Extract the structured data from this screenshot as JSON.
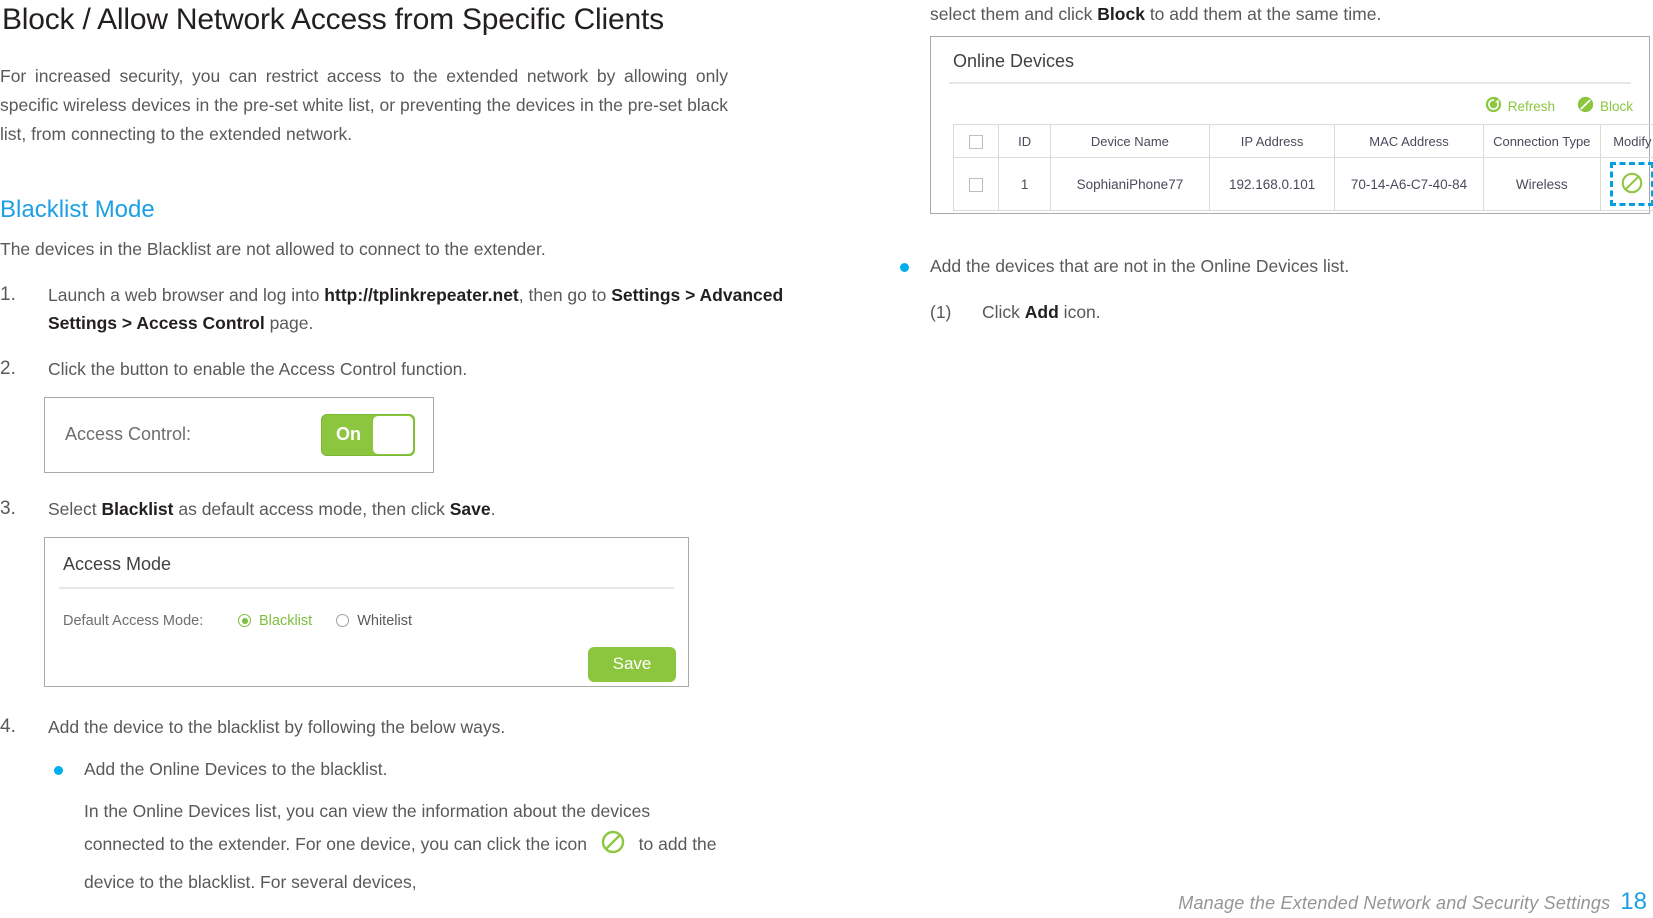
{
  "document": {
    "title": "Block / Allow Network Access from Specific Clients",
    "intro": "For increased security, you can restrict access to the extended network by allowing only specific wireless devices in the pre-set white list, or preventing the devices in the pre-set black list, from connecting to the extended network.",
    "section_title": "Blacklist Mode",
    "section_lead": "The devices in the Blacklist are not allowed to connect to the extender."
  },
  "steps": {
    "s1": {
      "num": "1.",
      "text_a": "Launch a web browser and log into ",
      "bold_a": "http://tplinkrepeater.net",
      "text_b": ", then go to ",
      "bold_b": "Settings > Advanced Settings > Access Control",
      "text_c": " page."
    },
    "s2": {
      "num": "2.",
      "text": "Click the button to enable the Access Control function."
    },
    "s3": {
      "num": "3.",
      "text_a": "Select ",
      "bold_a": "Blacklist",
      "text_b": " as default access mode, then click ",
      "bold_b": "Save",
      "text_c": "."
    },
    "s4": {
      "num": "4.",
      "text": "Add the device to the blacklist by following the below ways."
    }
  },
  "access_control": {
    "label": "Access Control:",
    "toggle_state": "On",
    "toggle_color": "#8cc63f"
  },
  "access_mode": {
    "panel_title": "Access Mode",
    "caption": "Default Access Mode:",
    "options": [
      {
        "label": "Blacklist",
        "selected": true
      },
      {
        "label": "Whitelist",
        "selected": false
      }
    ],
    "save_label": "Save",
    "accent_color": "#8cc63f"
  },
  "bullets": {
    "b1": "Add the Online Devices to the blacklist.",
    "b1_para_a": "In the Online Devices list, you can view the information about the devices connected to the extender. For one device, you can click the icon ",
    "b1_para_b": " to add the device to the blacklist. For several devices, ",
    "b1_para_c_right": "select them and click ",
    "b1_para_c_bold": "Block",
    "b1_para_c_tail": " to add them at the same time.",
    "b2": "Add the devices that are not in the Online Devices list.",
    "b2_sub_num": "(1)",
    "b2_sub_text_a": "Click ",
    "b2_sub_bold": "Add",
    "b2_sub_text_b": " icon.",
    "bullet_color": "#00aeef"
  },
  "online_devices": {
    "panel_title": "Online Devices",
    "actions": [
      {
        "label": "Refresh",
        "icon": "refresh-icon"
      },
      {
        "label": "Block",
        "icon": "block-icon"
      }
    ],
    "columns": [
      "",
      "ID",
      "Device Name",
      "IP Address",
      "MAC Address",
      "Connection Type",
      "Modify"
    ],
    "rows": [
      {
        "checked": false,
        "id": "1",
        "device_name": "SophianiPhone77",
        "ip_address": "192.168.0.101",
        "mac_address": "70-14-A6-C7-40-84",
        "connection_type": "Wireless",
        "modify_icon": "block-icon"
      }
    ],
    "annotation_color": "#00a0e3"
  },
  "footer": {
    "text": "Manage the Extended Network and Security Settings",
    "page_number": "18"
  }
}
